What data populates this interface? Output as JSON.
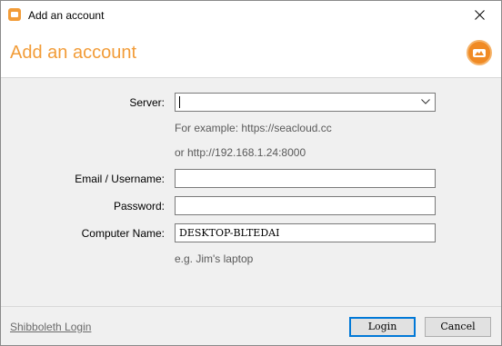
{
  "window": {
    "title": "Add an account",
    "close_icon": "close-icon",
    "app_icon": "seafile-app-icon"
  },
  "header": {
    "title": "Add an account",
    "logo_icon": "seafile-logo-icon",
    "accent_color": "#f29c38"
  },
  "form": {
    "server": {
      "label": "Server:",
      "value": "",
      "hint_1": "For example: https://seacloud.cc",
      "hint_2": "or http://192.168.1.24:8000"
    },
    "email": {
      "label": "Email / Username:",
      "value": ""
    },
    "password": {
      "label": "Password:",
      "value": ""
    },
    "computer_name": {
      "label": "Computer Name:",
      "value": "DESKTOP-BLTEDAI",
      "hint": "e.g. Jim's laptop"
    }
  },
  "footer": {
    "shibboleth_link": "Shibboleth Login",
    "login_label": "Login",
    "cancel_label": "Cancel"
  }
}
